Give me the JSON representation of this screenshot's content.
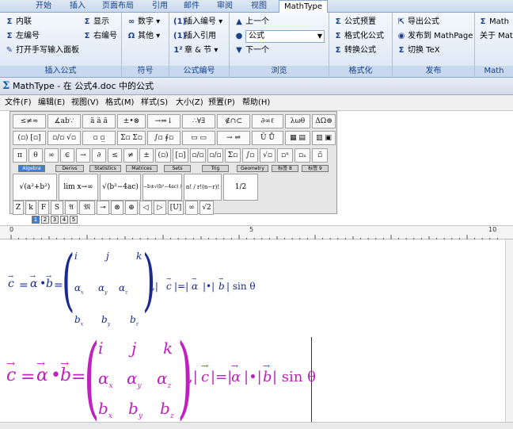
{
  "ribbon": {
    "tabs": [
      "开始",
      "插入",
      "页面布局",
      "引用",
      "邮件",
      "审阅",
      "视图",
      "MathType"
    ],
    "groups": {
      "insert_eq": {
        "label": "插入公式",
        "items": [
          "内联",
          "左编号",
          "打开手写输入面板",
          "显示",
          "右编号"
        ]
      },
      "symbols": {
        "label": "符号",
        "items": [
          "数字",
          "其他"
        ]
      },
      "eq_number": {
        "label": "公式编号",
        "items": [
          "插入编号",
          "插入引用",
          "章 & 节"
        ]
      },
      "browse": {
        "label": "浏览",
        "items": [
          "上一个",
          "公式",
          "下一个"
        ]
      },
      "format": {
        "label": "格式化",
        "items": [
          "公式预置",
          "格式化公式",
          "转换公式"
        ]
      },
      "publish": {
        "label": "发布",
        "items": [
          "导出公式",
          "发布到 MathPage",
          "切换 TeX"
        ]
      },
      "more": {
        "label": "Math",
        "items": [
          "Math",
          "关于 Mat"
        ]
      }
    }
  },
  "window": {
    "title": "MathType - 在 公式4.doc 中的公式",
    "logo": "Σ"
  },
  "menu": [
    "文件(F)",
    "编辑(E)",
    "视图(V)",
    "格式(M)",
    "样式(S)",
    "大小(Z)",
    "预置(P)",
    "帮助(H)"
  ],
  "palette": {
    "row1": [
      "≤≠≈",
      "∡ab∵",
      "±•⊗",
      "→⇔↓",
      "∴∀∃",
      "∉∩⊂",
      "∂∞ℓ",
      "λωθ",
      "ΔΩ⊛"
    ],
    "row2": [
      "(▫) [▫]",
      "▫/▫ √▫",
      "▫ ▫̲",
      "Σ▫ Σ▫",
      "∫▫ ∮▫",
      "▭ ▭",
      "→ ⇌",
      "Ū Ů",
      "▦ ▤",
      "▥ ▣"
    ],
    "row3": [
      "π",
      "θ",
      "∞",
      "∈",
      "→",
      "∂",
      "≤",
      "≠",
      "±",
      "(▫)",
      "[▫]",
      "▫/▫",
      "▫/▫",
      "Σ▫",
      "∫▫",
      "√▫",
      "▫ˣ",
      "▫ₓ",
      "▫̃"
    ],
    "tabs": [
      "Algebra",
      "Derivs",
      "Statistics",
      "Matrices",
      "Sets",
      "Trig",
      "Geometry",
      "标签 8",
      "标签 9"
    ],
    "templates": [
      "√(a²+b²)",
      "lim x→∞",
      "√(b²−4ac)",
      "−b±√(b²−4ac) / 2a",
      "n! / r!(n−r)!",
      "1/2"
    ],
    "row5": [
      "Z",
      "k",
      "F",
      "S",
      "𝔄",
      "𝔐",
      "⊸",
      "⊗",
      "⊕",
      "◁",
      "▷",
      "[U]",
      "∞",
      "√2"
    ]
  },
  "zoom_buttons": [
    "1",
    "2",
    "3",
    "4",
    "5"
  ],
  "ruler": [
    "0",
    "5",
    "10"
  ],
  "equation": {
    "c": "c",
    "eq": "=",
    "alpha": "α",
    "dot": "•",
    "b": "b",
    "matrix": [
      [
        "i",
        "j",
        "k"
      ],
      [
        "α",
        "α",
        "α"
      ],
      [
        "b",
        "b",
        "b"
      ]
    ],
    "subs": [
      "x",
      "y",
      "z"
    ],
    "tail": ",| c |=| α |•| b | sin θ",
    "tail_parts": [
      ",|",
      "c",
      "|=|",
      "α",
      "|•|",
      "b",
      "| sin θ"
    ]
  }
}
